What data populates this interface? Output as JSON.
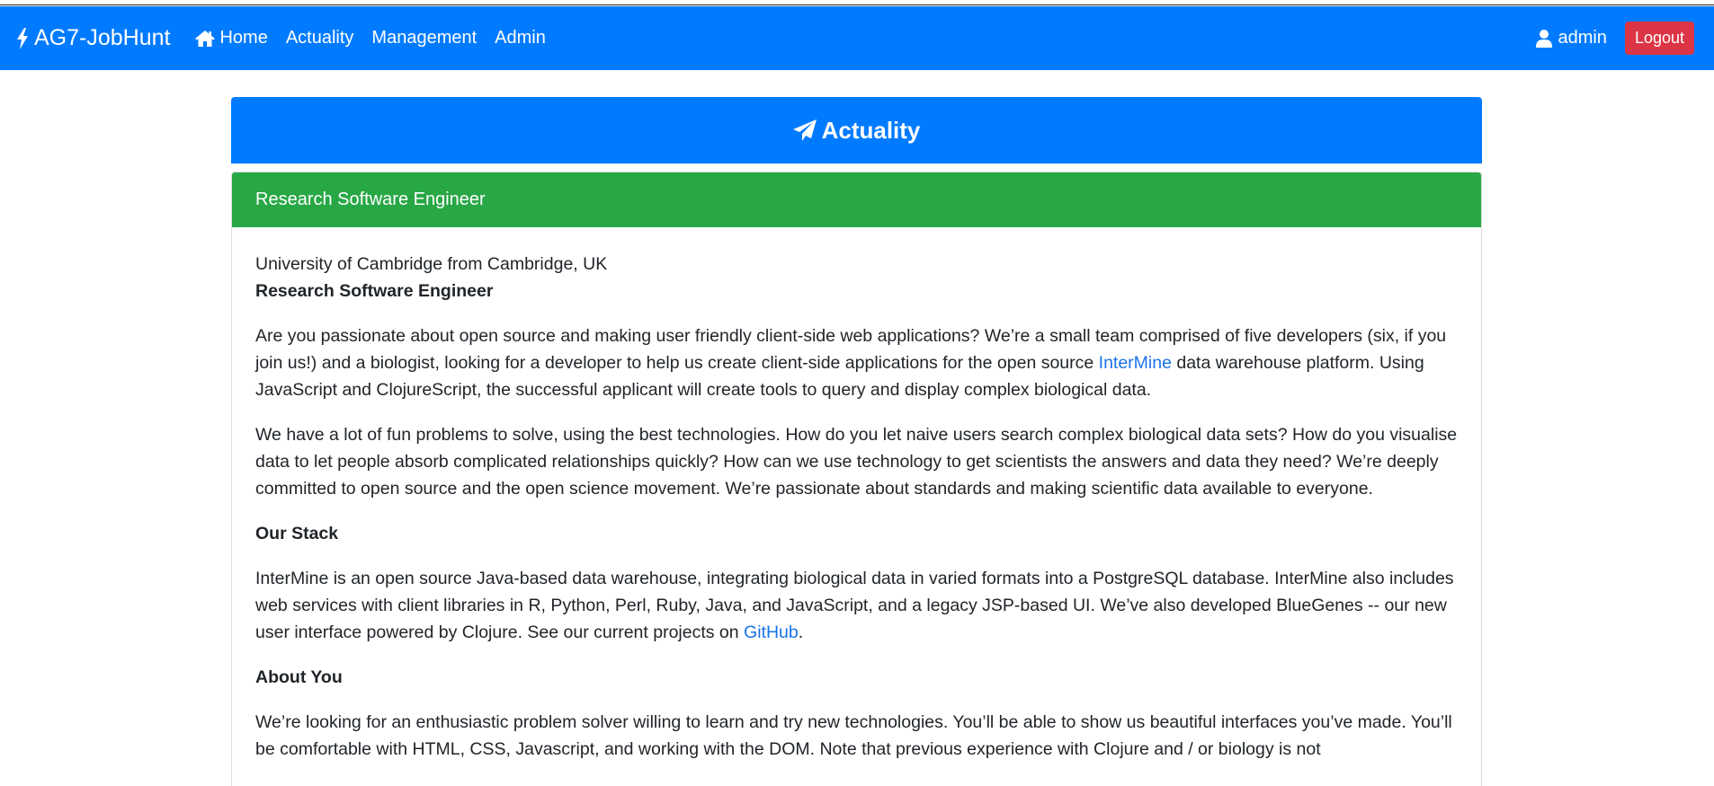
{
  "navbar": {
    "brand": "AG7-JobHunt",
    "links": [
      {
        "label": "Home",
        "icon": "home-icon"
      },
      {
        "label": "Actuality"
      },
      {
        "label": "Management"
      },
      {
        "label": "Admin"
      }
    ],
    "user": "admin",
    "logout": "Logout"
  },
  "page": {
    "title": "Actuality",
    "title_icon": "paper-plane-icon"
  },
  "job": {
    "header": "Research Software Engineer",
    "company_line": "University of Cambridge from Cambridge, UK",
    "title": "Research Software Engineer",
    "p1_a": "Are you passionate about open source and making user friendly client-side web applications? We’re a small team comprised of five developers (six, if you join us!) and a biologist, looking for a developer to help us create client-side applications for the open source ",
    "p1_link": "InterMine",
    "p1_b": " data warehouse platform. Using JavaScript and ClojureScript, the successful applicant will create tools to query and display complex biological data.",
    "p2": "We have a lot of fun problems to solve, using the best technologies. How do you let naive users search complex biological data sets? How do you visualise data to let people absorb complicated relationships quickly? How can we use technology to get scientists the answers and data they need? We’re deeply committed to open source and the open science movement. We’re passionate about standards and making scientific data available to everyone.",
    "h_stack": "Our Stack",
    "p3_a": "InterMine is an open source Java-based data warehouse, integrating biological data in varied formats into a PostgreSQL database. InterMine also includes  web services with client libraries in R, Python, Perl, Ruby, Java, and JavaScript, and a legacy JSP-based UI. We’ve also developed  BlueGenes -- our new user interface powered by Clojure. See our current projects on ",
    "p3_link": "GitHub",
    "p3_b": ".",
    "h_about": "About You",
    "p4": "We’re looking for an enthusiastic problem solver willing to learn and try new technologies. You’ll be able to show us beautiful interfaces you’ve made. You’ll be comfortable with HTML, CSS, Javascript, and working with the DOM. Note that previous experience with Clojure and / or biology is not"
  },
  "colors": {
    "primary": "#007bff",
    "success": "#28a745",
    "danger": "#dc3545",
    "link": "#1a73e8"
  }
}
